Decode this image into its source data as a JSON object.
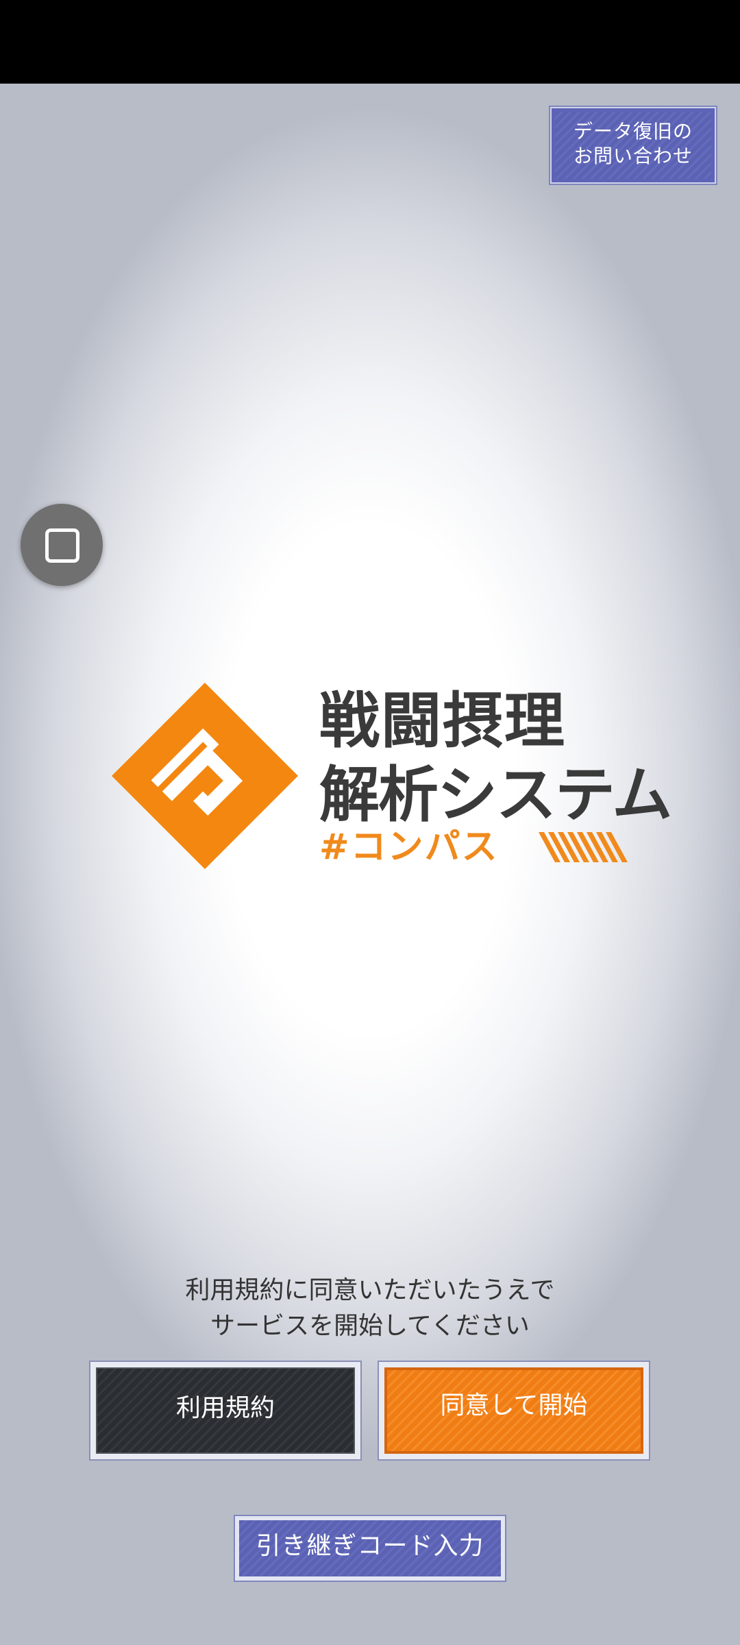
{
  "recovery_button": {
    "line1": "データ復旧の",
    "line2": "お問い合わせ"
  },
  "logo": {
    "title_line1": "戦闘摂理",
    "title_line2": "解析システム",
    "title_line3": "#コンパス",
    "brand_color": "#f08a1c"
  },
  "notice": {
    "line1": "利用規約に同意いただいたうえで",
    "line2": "サービスを開始してください"
  },
  "buttons": {
    "terms": "利用規約",
    "agree": "同意して開始",
    "transfer": "引き継ぎコード入力"
  }
}
